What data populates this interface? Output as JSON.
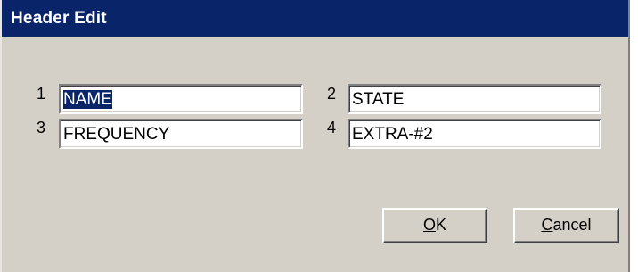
{
  "window": {
    "title": "Header Edit"
  },
  "fields": [
    {
      "index": "1",
      "value": "NAME",
      "selected": true
    },
    {
      "index": "2",
      "value": "STATE",
      "selected": false
    },
    {
      "index": "3",
      "value": "FREQUENCY",
      "selected": false
    },
    {
      "index": "4",
      "value": "EXTRA-#2",
      "selected": false
    }
  ],
  "buttons": {
    "ok": {
      "mnemonic": "O",
      "rest": "K"
    },
    "cancel": {
      "mnemonic": "C",
      "rest": "ancel"
    }
  },
  "colors": {
    "titlebar": "#0a246a",
    "face": "#d4d0c8",
    "selection": "#0a246a"
  }
}
